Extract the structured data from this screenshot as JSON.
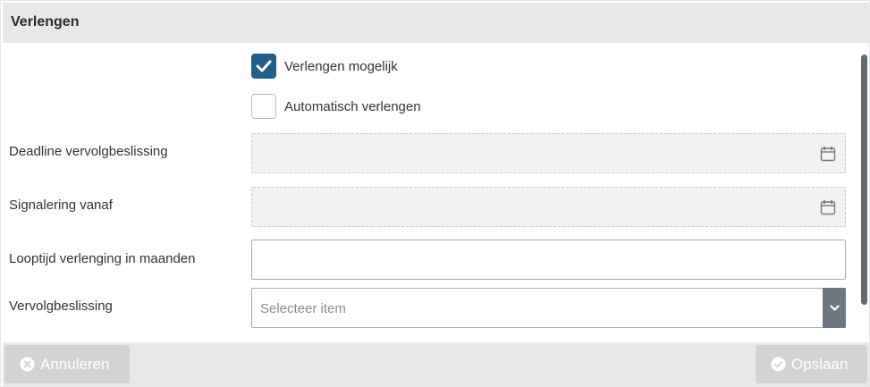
{
  "dialog": {
    "title": "Verlengen"
  },
  "form": {
    "verlengen_mogelijk": {
      "label": "Verlengen mogelijk",
      "checked": true
    },
    "automatisch_verlengen": {
      "label": "Automatisch verlengen",
      "checked": false
    },
    "deadline": {
      "label": "Deadline vervolgbeslissing",
      "value": "",
      "disabled": true,
      "icon": "calendar-icon"
    },
    "signalering": {
      "label": "Signalering vanaf",
      "value": "",
      "disabled": true,
      "icon": "calendar-icon"
    },
    "looptijd": {
      "label": "Looptijd verlenging in maanden",
      "value": ""
    },
    "vervolgbeslissing": {
      "label": "Vervolgbeslissing",
      "placeholder": "Selecteer item",
      "icon": "chevron-down-icon"
    }
  },
  "footer": {
    "cancel_label": "Annuleren",
    "cancel_icon": "close-circle-icon",
    "save_label": "Opslaan",
    "save_icon": "check-circle-icon"
  },
  "colors": {
    "accent": "#1f5f8b",
    "header_bg": "#e8e8e8",
    "button_disabled": "#d3d3d3",
    "select_button": "#6c7780"
  }
}
